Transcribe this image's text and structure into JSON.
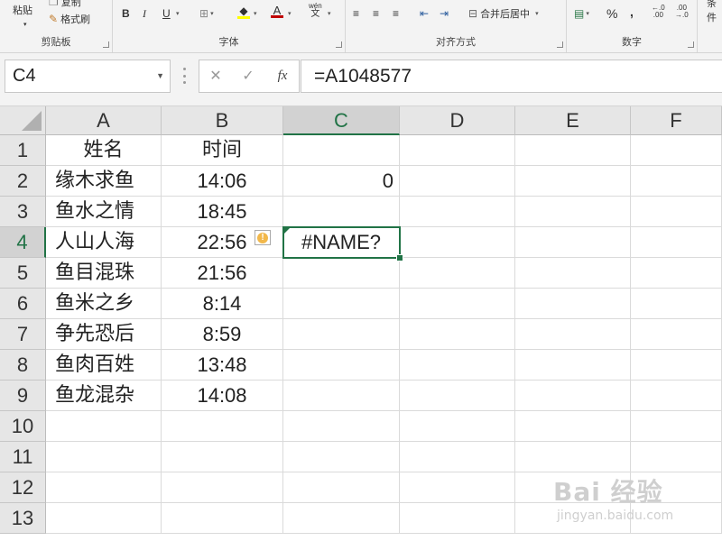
{
  "ribbon": {
    "clipboard": {
      "label": "剪贴板",
      "paste_label": "粘贴",
      "copy_label": "复制",
      "format_painter_label": "格式刷"
    },
    "font": {
      "label": "字体",
      "bold": "B",
      "italic": "I",
      "underline": "U",
      "pinyin_label": "wén"
    },
    "alignment": {
      "label": "对齐方式",
      "merge_center_label": "合并后居中"
    },
    "number": {
      "label": "数字",
      "percent": "%",
      "comma": ","
    },
    "styles": {
      "conditional_partial": "条件"
    },
    "colors": {
      "font_color": "#c00000",
      "fill_color": "#ffff00",
      "accent": "#217346"
    }
  },
  "formula_bar": {
    "name_box": "C4",
    "cancel_icon": "✕",
    "enter_icon": "✓",
    "fx_label": "fx",
    "formula": "=A1048577"
  },
  "grid": {
    "columns": [
      "A",
      "B",
      "C",
      "D",
      "E",
      "F"
    ],
    "rows": [
      "1",
      "2",
      "3",
      "4",
      "5",
      "6",
      "7",
      "8",
      "9",
      "10",
      "11",
      "12",
      "13"
    ],
    "active_cell": "C4",
    "header": {
      "a1": "姓名",
      "b1": "时间"
    },
    "data": [
      {
        "name": "缘木求鱼",
        "time": "14:06"
      },
      {
        "name": "鱼水之情",
        "time": "18:45"
      },
      {
        "name": "人山人海",
        "time": "22:56"
      },
      {
        "name": "鱼目混珠",
        "time": "21:56"
      },
      {
        "name": "鱼米之乡",
        "time": "8:14"
      },
      {
        "name": "争先恐后",
        "time": "8:59"
      },
      {
        "name": "鱼肉百姓",
        "time": "13:48"
      },
      {
        "name": "鱼龙混杂",
        "time": "14:08"
      }
    ],
    "c2": "0",
    "c4": "#NAME?"
  },
  "watermark": {
    "logo": "Bai 经验",
    "url": "jingyan.baidu.com"
  }
}
